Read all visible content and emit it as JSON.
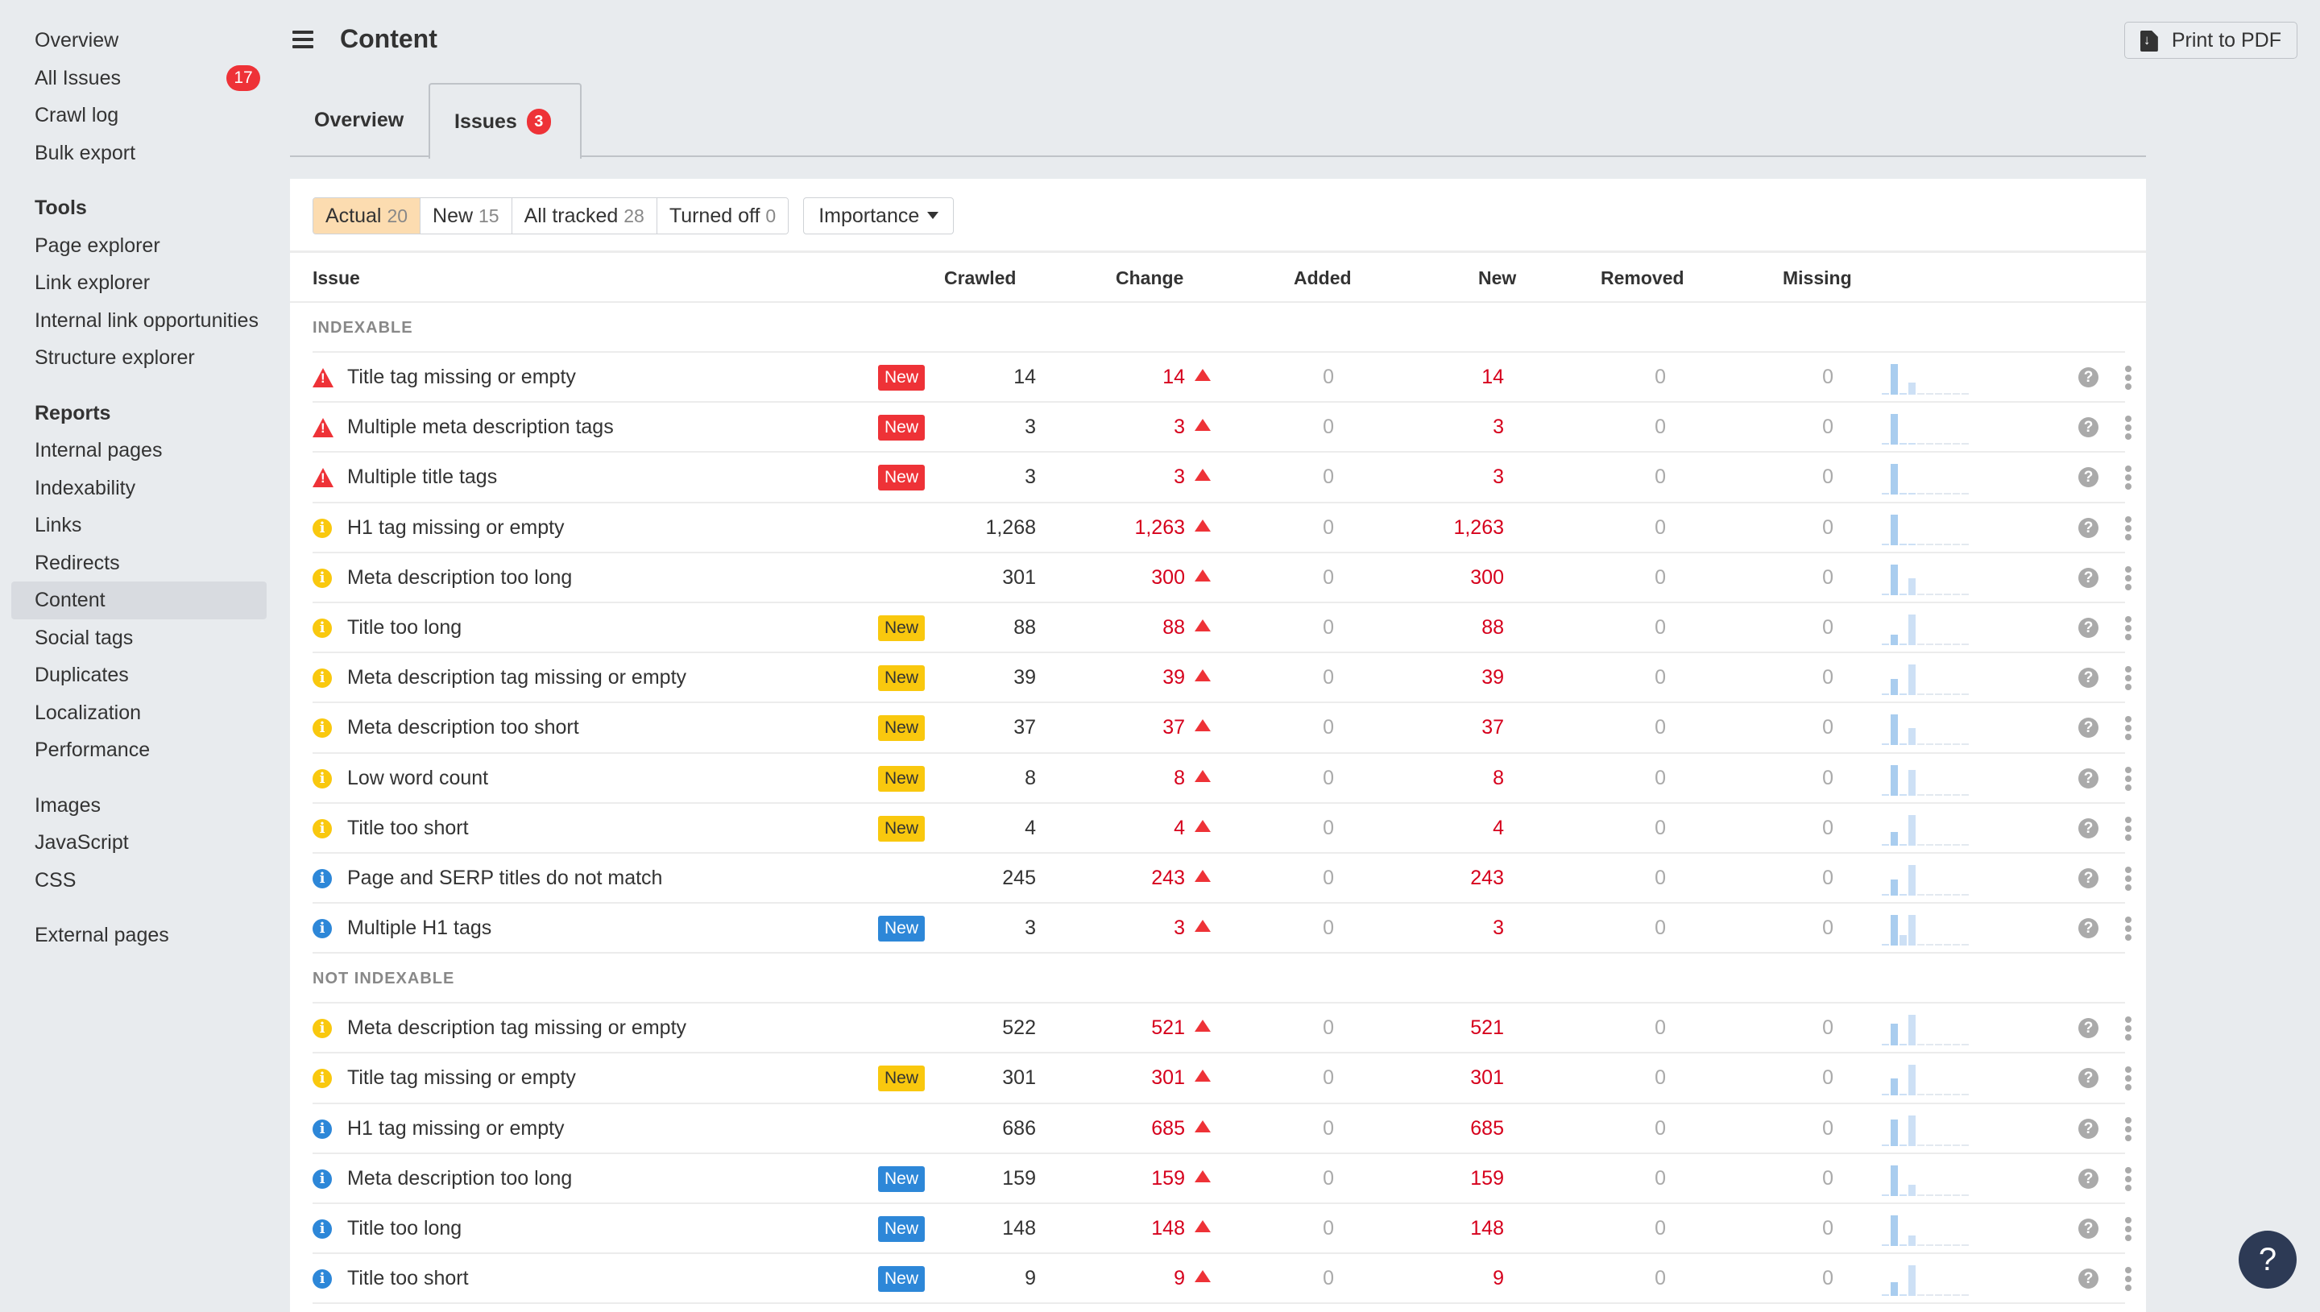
{
  "sidebar": {
    "groups": [
      {
        "heading": null,
        "items": [
          {
            "label": "Overview"
          },
          {
            "label": "All Issues",
            "badge": "17"
          },
          {
            "label": "Crawl log"
          },
          {
            "label": "Bulk export"
          }
        ]
      },
      {
        "heading": "Tools",
        "items": [
          {
            "label": "Page explorer"
          },
          {
            "label": "Link explorer"
          },
          {
            "label": "Internal link opportunities"
          },
          {
            "label": "Structure explorer"
          }
        ]
      },
      {
        "heading": "Reports",
        "items": [
          {
            "label": "Internal pages"
          },
          {
            "label": "Indexability"
          },
          {
            "label": "Links"
          },
          {
            "label": "Redirects"
          },
          {
            "label": "Content",
            "active": true
          },
          {
            "label": "Social tags"
          },
          {
            "label": "Duplicates"
          },
          {
            "label": "Localization"
          },
          {
            "label": "Performance"
          }
        ]
      },
      {
        "heading": null,
        "items": [
          {
            "label": "Images"
          },
          {
            "label": "JavaScript"
          },
          {
            "label": "CSS"
          }
        ]
      },
      {
        "heading": null,
        "items": [
          {
            "label": "External pages"
          }
        ]
      }
    ]
  },
  "header": {
    "title": "Content",
    "menu_icon": "hamburger-icon",
    "print_button": {
      "label": "Print to PDF",
      "icon": "file-download-icon"
    }
  },
  "tabs": [
    {
      "label": "Overview",
      "active": false
    },
    {
      "label": "Issues",
      "active": true,
      "badge": "3"
    }
  ],
  "filters": {
    "segments": [
      {
        "label": "Actual",
        "count": "20",
        "active": true
      },
      {
        "label": "New",
        "count": "15",
        "active": false
      },
      {
        "label": "All tracked",
        "count": "28",
        "active": false
      },
      {
        "label": "Turned off",
        "count": "0",
        "active": false
      }
    ],
    "sort_dropdown": "Importance"
  },
  "table": {
    "columns": [
      "Issue",
      "Crawled",
      "Change",
      "Added",
      "New",
      "Removed",
      "Missing"
    ],
    "new_badge_label": "New",
    "colors": {
      "error": "#ee3237",
      "warning": "#f9c80e",
      "notice": "#2d87d8",
      "change": "#d6001c"
    },
    "sections": [
      {
        "label": "INDEXABLE",
        "rows": [
          {
            "severity": "error",
            "issue": "Title tag missing or empty",
            "is_new": true,
            "crawled": "14",
            "change": "14",
            "added": "0",
            "new": "14",
            "removed": "0",
            "missing": "0",
            "trend": [
              0,
              100,
              0,
              40,
              0,
              0,
              0,
              0,
              0,
              0
            ]
          },
          {
            "severity": "error",
            "issue": "Multiple meta description tags",
            "is_new": true,
            "crawled": "3",
            "change": "3",
            "added": "0",
            "new": "3",
            "removed": "0",
            "missing": "0",
            "trend": [
              0,
              100,
              0,
              0,
              0,
              0,
              0,
              0,
              0,
              0
            ]
          },
          {
            "severity": "error",
            "issue": "Multiple title tags",
            "is_new": true,
            "crawled": "3",
            "change": "3",
            "added": "0",
            "new": "3",
            "removed": "0",
            "missing": "0",
            "trend": [
              0,
              100,
              0,
              0,
              0,
              0,
              0,
              0,
              0,
              0
            ]
          },
          {
            "severity": "warning",
            "issue": "H1 tag missing or empty",
            "is_new": false,
            "crawled": "1,268",
            "change": "1,263",
            "added": "0",
            "new": "1,263",
            "removed": "0",
            "missing": "0",
            "trend": [
              0,
              100,
              0,
              0,
              0,
              0,
              0,
              0,
              0,
              0
            ]
          },
          {
            "severity": "warning",
            "issue": "Meta description too long",
            "is_new": false,
            "crawled": "301",
            "change": "300",
            "added": "0",
            "new": "300",
            "removed": "0",
            "missing": "0",
            "trend": [
              0,
              100,
              0,
              55,
              0,
              0,
              0,
              0,
              0,
              0
            ]
          },
          {
            "severity": "warning",
            "issue": "Title too long",
            "is_new": true,
            "crawled": "88",
            "change": "88",
            "added": "0",
            "new": "88",
            "removed": "0",
            "missing": "0",
            "trend": [
              0,
              35,
              0,
              100,
              0,
              0,
              0,
              0,
              0,
              0
            ]
          },
          {
            "severity": "warning",
            "issue": "Meta description tag missing or empty",
            "is_new": true,
            "crawled": "39",
            "change": "39",
            "added": "0",
            "new": "39",
            "removed": "0",
            "missing": "0",
            "trend": [
              0,
              52,
              0,
              100,
              0,
              0,
              0,
              0,
              0,
              0
            ]
          },
          {
            "severity": "warning",
            "issue": "Meta description too short",
            "is_new": true,
            "crawled": "37",
            "change": "37",
            "added": "0",
            "new": "37",
            "removed": "0",
            "missing": "0",
            "trend": [
              0,
              100,
              0,
              55,
              0,
              0,
              0,
              0,
              0,
              0
            ]
          },
          {
            "severity": "warning",
            "issue": "Low word count",
            "is_new": true,
            "crawled": "8",
            "change": "8",
            "added": "0",
            "new": "8",
            "removed": "0",
            "missing": "0",
            "trend": [
              0,
              100,
              0,
              85,
              0,
              0,
              0,
              0,
              0,
              0
            ]
          },
          {
            "severity": "warning",
            "issue": "Title too short",
            "is_new": true,
            "crawled": "4",
            "change": "4",
            "added": "0",
            "new": "4",
            "removed": "0",
            "missing": "0",
            "trend": [
              0,
              44,
              0,
              100,
              0,
              0,
              0,
              0,
              0,
              0
            ]
          },
          {
            "severity": "notice",
            "issue": "Page and SERP titles do not match",
            "is_new": false,
            "crawled": "245",
            "change": "243",
            "added": "0",
            "new": "243",
            "removed": "0",
            "missing": "0",
            "trend": [
              0,
              53,
              0,
              100,
              0,
              0,
              0,
              0,
              0,
              0
            ]
          },
          {
            "severity": "notice",
            "issue": "Multiple H1 tags",
            "is_new": true,
            "crawled": "3",
            "change": "3",
            "added": "0",
            "new": "3",
            "removed": "0",
            "missing": "0",
            "trend": [
              0,
              100,
              33,
              100,
              0,
              0,
              0,
              0,
              0,
              0
            ]
          }
        ]
      },
      {
        "label": "NOT INDEXABLE",
        "rows": [
          {
            "severity": "warning",
            "issue": "Meta description tag missing or empty",
            "is_new": false,
            "crawled": "522",
            "change": "521",
            "added": "0",
            "new": "521",
            "removed": "0",
            "missing": "0",
            "trend": [
              0,
              70,
              0,
              100,
              0,
              0,
              0,
              0,
              0,
              0
            ]
          },
          {
            "severity": "warning",
            "issue": "Title tag missing or empty",
            "is_new": true,
            "crawled": "301",
            "change": "301",
            "added": "0",
            "new": "301",
            "removed": "0",
            "missing": "0",
            "trend": [
              0,
              55,
              0,
              100,
              0,
              0,
              0,
              0,
              0,
              0
            ]
          },
          {
            "severity": "notice",
            "issue": "H1 tag missing or empty",
            "is_new": false,
            "crawled": "686",
            "change": "685",
            "added": "0",
            "new": "685",
            "removed": "0",
            "missing": "0",
            "trend": [
              0,
              86,
              0,
              100,
              0,
              0,
              0,
              0,
              0,
              0
            ]
          },
          {
            "severity": "notice",
            "issue": "Meta description too long",
            "is_new": true,
            "crawled": "159",
            "change": "159",
            "added": "0",
            "new": "159",
            "removed": "0",
            "missing": "0",
            "trend": [
              0,
              100,
              0,
              36,
              0,
              0,
              0,
              0,
              0,
              0
            ]
          },
          {
            "severity": "notice",
            "issue": "Title too long",
            "is_new": true,
            "crawled": "148",
            "change": "148",
            "added": "0",
            "new": "148",
            "removed": "0",
            "missing": "0",
            "trend": [
              0,
              100,
              0,
              33,
              0,
              0,
              0,
              0,
              0,
              0
            ]
          },
          {
            "severity": "notice",
            "issue": "Title too short",
            "is_new": true,
            "crawled": "9",
            "change": "9",
            "added": "0",
            "new": "9",
            "removed": "0",
            "missing": "0",
            "trend": [
              0,
              44,
              0,
              100,
              0,
              0,
              0,
              0,
              0,
              0
            ]
          }
        ]
      }
    ]
  },
  "help_fab": {
    "label": "?"
  }
}
